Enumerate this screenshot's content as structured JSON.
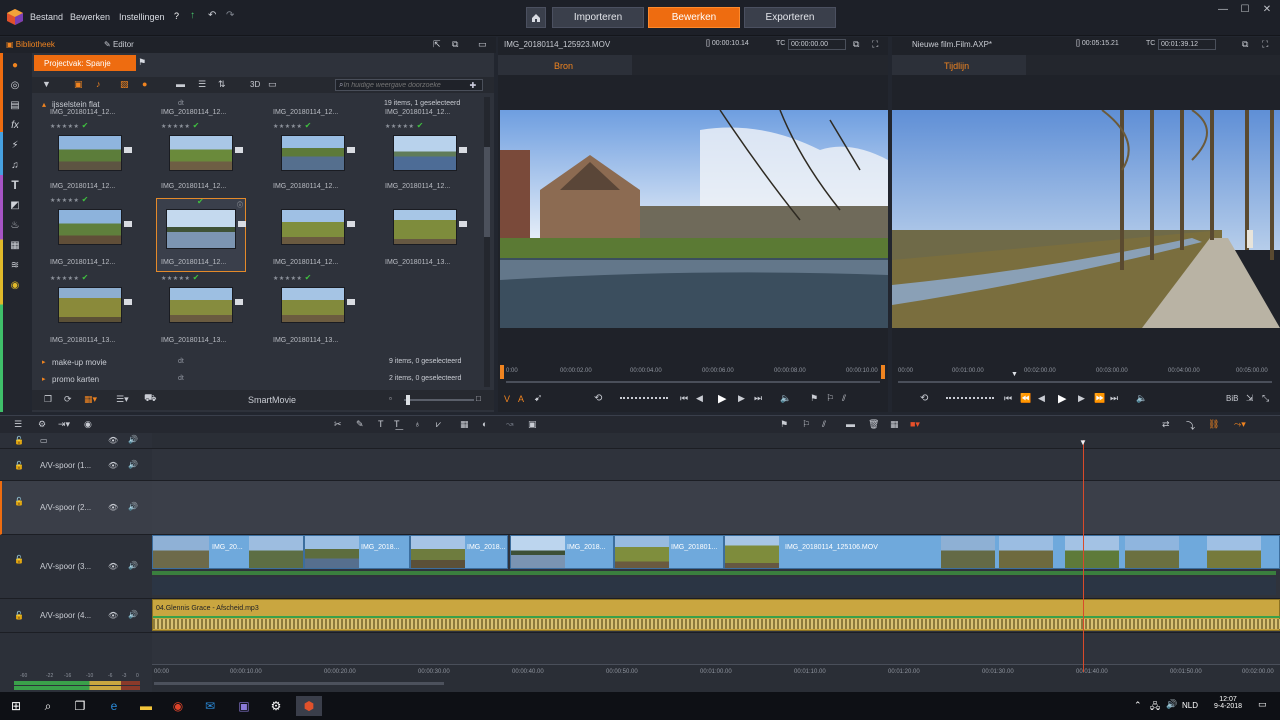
{
  "menubar": {
    "items": [
      "Bestand",
      "Bewerken",
      "Instellingen"
    ],
    "modes": [
      "Importeren",
      "Bewerken",
      "Exporteren"
    ],
    "active_mode": "Bewerken"
  },
  "library": {
    "tabs": [
      "Bibliotheek",
      "Editor"
    ],
    "project_tab": "Projectvak: Spanje",
    "search_placeholder": "In huidige weergave doorzoeke",
    "view_3d": "3D",
    "groups": [
      {
        "name": "ijsselstein flat",
        "info": "19 items, 1 geselecteerd"
      },
      {
        "name": "make-up movie",
        "info": "9 items, 0 geselecteerd"
      },
      {
        "name": "promo karten",
        "info": "2 items, 0 geselecteerd"
      }
    ],
    "thumb_rows": [
      [
        "IMG_20180114_12...",
        "IMG_20180114_12...",
        "IMG_20180114_12...",
        "IMG_20180114_12..."
      ],
      [
        "IMG_20180114_12...",
        "IMG_20180114_12...",
        "IMG_20180114_12...",
        "IMG_20180114_12..."
      ],
      [
        "IMG_20180114_12...",
        "IMG_20180114_12...",
        "IMG_20180114_12...",
        "IMG_20180114_13..."
      ],
      [
        "IMG_20180114_13...",
        "IMG_20180114_13...",
        "IMG_20180114_13..."
      ]
    ],
    "smartmovie": "SmartMovie"
  },
  "source_viewer": {
    "filename": "IMG_20180114_125923.MOV",
    "duration": "00:00:10.14",
    "tc": "00:00:00.00",
    "tab": "Bron",
    "ruler": [
      "0:00",
      "00:00:02.00",
      "00:00:04.00",
      "00:00:06.00",
      "00:00:08.00",
      "00:00:10.00"
    ],
    "marks": [
      "V",
      "A"
    ]
  },
  "timeline_viewer": {
    "filename": "Nieuwe film.Film.AXP*",
    "duration": "00:05:15.21",
    "tc": "00:01:39.12",
    "tab": "Tijdlijn",
    "ruler": [
      "00:00",
      "00:01:00.00",
      "00:02:00.00",
      "00:03:00.00",
      "00:04:00.00",
      "00:05:00.00"
    ],
    "bib": "BiB"
  },
  "tracks": [
    {
      "name": "A/V-spoor (1..."
    },
    {
      "name": "A/V-spoor (2..."
    },
    {
      "name": "A/V-spoor (3..."
    },
    {
      "name": "A/V-spoor (4..."
    }
  ],
  "clips": [
    {
      "label": "IMG_20..."
    },
    {
      "label": "IMG_2018..."
    },
    {
      "label": "IMG_2018..."
    },
    {
      "label": "IMG_2018..."
    },
    {
      "label": "IMG_201801..."
    },
    {
      "label": "IMG_20180114_125106.MOV"
    }
  ],
  "audio_clip": "04.Glennis Grace - Afscheid.mp3",
  "timeline_ruler": [
    "00:00",
    "00:00:10.00",
    "00:00:20.00",
    "00:00:30.00",
    "00:00:40.00",
    "00:00:50.00",
    "00:01:00.00",
    "00:01:10.00",
    "00:01:20.00",
    "00:01:30.00",
    "00:01:40.00",
    "00:01:50.00",
    "00:02:00.00"
  ],
  "vu_scale": [
    "-60",
    "-22",
    "-16",
    "-10",
    "-6",
    "-3",
    "0"
  ],
  "taskbar": {
    "lang": "NLD",
    "time": "12:07",
    "date": "9-4-2018"
  },
  "colors": {
    "accent": "#ee6c10",
    "clip": "#6fa9dc",
    "audio": "#c9a640"
  }
}
